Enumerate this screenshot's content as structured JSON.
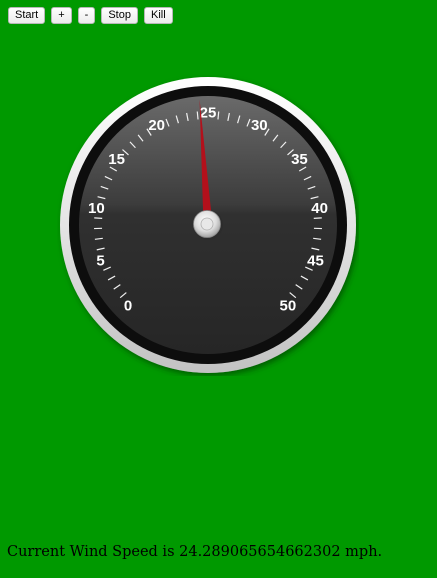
{
  "toolbar": {
    "start_label": "Start",
    "plus_label": "+",
    "minus_label": "-",
    "stop_label": "Stop",
    "kill_label": "Kill"
  },
  "gauge": {
    "min": 0,
    "max": 50,
    "major_step": 5,
    "minor_per_major": 4,
    "tick_labels": [
      "0",
      "5",
      "10",
      "15",
      "20",
      "25",
      "30",
      "35",
      "40",
      "45",
      "50"
    ],
    "value": 24.289065654662302,
    "needle_color": "#b3101b"
  },
  "status": {
    "text": "Current Wind Speed is 24.289065654662302 mph."
  }
}
